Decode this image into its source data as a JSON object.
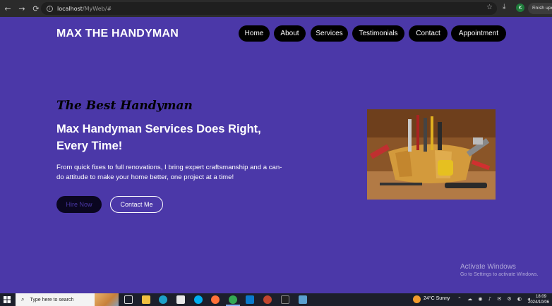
{
  "browser": {
    "url_host": "localhost",
    "url_path": "/MyWeb/#",
    "profile_initial": "K",
    "update_label": "Finish update"
  },
  "site": {
    "logo": "MAX THE HANDYMAN",
    "nav": [
      {
        "label": "Home"
      },
      {
        "label": "About"
      },
      {
        "label": "Services"
      },
      {
        "label": "Testimonials"
      },
      {
        "label": "Contact"
      },
      {
        "label": "Appointment"
      }
    ]
  },
  "hero": {
    "tagline": "The Best Handyman",
    "headline": "Max Handyman Services Does Right, Every Time!",
    "description": "From quick fixes to full renovations, I bring expert craftsmanship and a can-do attitude to make your home better, one project at a time!",
    "hire_label": "Hire Now",
    "contact_label": "Contact Me"
  },
  "watermark": {
    "title": "Activate Windows",
    "subtitle": "Go to Settings to activate Windows."
  },
  "taskbar": {
    "search_placeholder": "Type here to search",
    "weather": "24°C  Sunny",
    "time": "18:09",
    "date": "2024/10/06"
  },
  "colors": {
    "page_bg": "#4b38a8",
    "nav_bg": "#000000",
    "tagline": "#000000"
  }
}
